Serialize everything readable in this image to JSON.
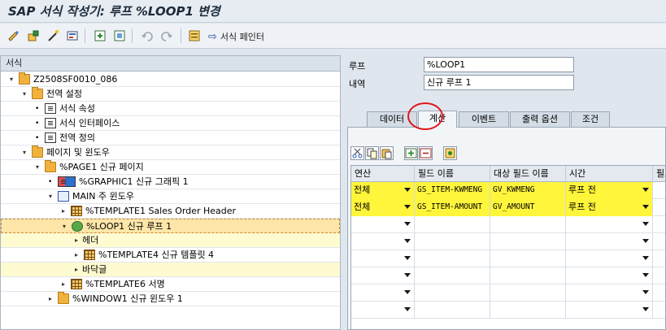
{
  "window": {
    "title": "SAP 서식 작성기: 루프 %LOOP1 변경"
  },
  "toolbar": {
    "icons": [
      "display-change-icon",
      "other-object-icon",
      "wizard-icon",
      "form-check-icon",
      "activate-icon",
      "form-interface-icon",
      "undo-icon",
      "redo-icon",
      "settings-icon"
    ],
    "painter_label": "서식 페인터"
  },
  "tree": {
    "header": "서식",
    "rows": [
      {
        "label": "Z2508SF0010_086",
        "kind": "folder",
        "exp": "▾"
      },
      {
        "label": "전역 설정",
        "kind": "folder",
        "exp": "▾"
      },
      {
        "label": "서식 속성",
        "kind": "doc",
        "exp": "•"
      },
      {
        "label": "서식 인터페이스",
        "kind": "doc",
        "exp": "•"
      },
      {
        "label": "전역 정의",
        "kind": "doc",
        "exp": "•"
      },
      {
        "label": "페이지 및 윈도우",
        "kind": "folder",
        "exp": "▾"
      },
      {
        "label": "%PAGE1 신규 페이지",
        "kind": "folder",
        "exp": "▾"
      },
      {
        "label": "%GRAPHIC1 신규 그래픽 1",
        "kind": "graphic",
        "exp": "•"
      },
      {
        "label": "MAIN 주 윈도우",
        "kind": "window",
        "exp": "▾"
      },
      {
        "label": "%TEMPLATE1 Sales Order Header",
        "kind": "grid",
        "exp": "▸"
      },
      {
        "label": "%LOOP1 신규 루프 1",
        "kind": "loop",
        "exp": "▾"
      },
      {
        "label": "헤더",
        "kind": "none",
        "exp": "▸"
      },
      {
        "label": "%TEMPLATE4 신규 템플릿 4",
        "kind": "grid",
        "exp": "▸"
      },
      {
        "label": "바닥글",
        "kind": "none",
        "exp": "▸"
      },
      {
        "label": "%TEMPLATE6 서명",
        "kind": "grid",
        "exp": "▸"
      },
      {
        "label": "%WINDOW1 신규 윈도우 1",
        "kind": "window2",
        "exp": "▸"
      }
    ]
  },
  "detail": {
    "loop_label": "루프",
    "loop_value": "%LOOP1",
    "desc_label": "내역",
    "desc_value": "신규 루프 1",
    "tabs": [
      "데이터",
      "계산",
      "이벤트",
      "출력 옵션",
      "조건"
    ],
    "active_tab": "계산",
    "columns": [
      "연산",
      "필드 이름",
      "대상 필드 이름",
      "시간",
      "필드"
    ],
    "rows": [
      {
        "op": "전체",
        "field": "GS_ITEM-KWMENG",
        "target": "GV_KWMENG",
        "time": "루프 전"
      },
      {
        "op": "전체",
        "field": "GS_ITEM-AMOUNT",
        "target": "GV_AMOUNT",
        "time": "루프 전"
      }
    ],
    "empty_rows": 6
  }
}
